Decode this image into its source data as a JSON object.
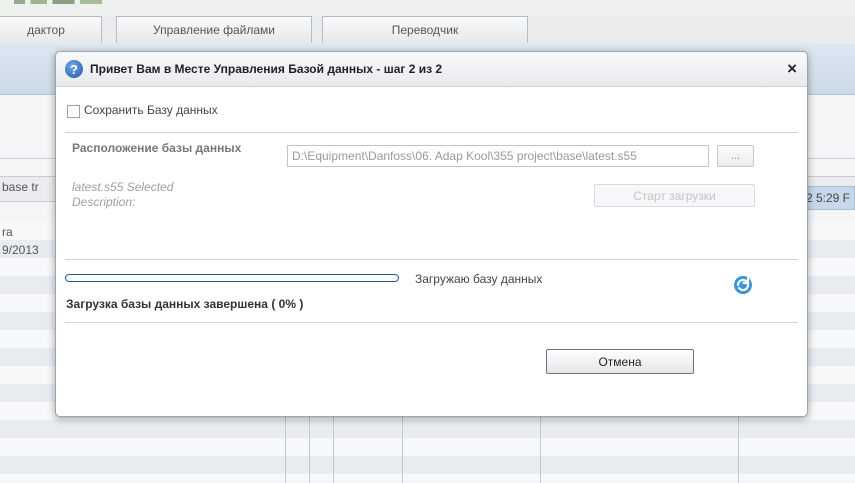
{
  "app": {
    "tabs": [
      {
        "label": "дактор"
      },
      {
        "label": "Управление файлами"
      },
      {
        "label": "Переводчик"
      }
    ],
    "bg_column_label": "base tr",
    "bg_row_label": "ra",
    "bg_row_date": "9/2013",
    "bg_time": "2 5:29 F"
  },
  "dialog": {
    "title": "Привет Вам в Месте Управления Базой данных - шаг 2 из 2",
    "close_glyph": "×",
    "help_glyph": "?",
    "save_checkbox_label": "Сохранить Базу данных",
    "save_checked": false,
    "location_label": "Расположение базы данных",
    "location_value": "D:\\Equipment\\Danfoss\\06. Adap Kool\\355 project\\base\\latest.s55",
    "browse_label": "...",
    "selected_text": "latest.s55 Selected",
    "description_text": "Description:",
    "start_button": "Старт загрузки",
    "progress_value": 0,
    "progress_status": "Загружаю базу данных",
    "completion_text": "Загрузка базы данных завершена ( 0% )",
    "cancel_button": "Отмена",
    "refresh_icon": "refresh-icon"
  },
  "colors": {
    "accent": "#3c7bc2",
    "title_bg": "#e7eaed",
    "refresh_icon": "#3a96d6"
  }
}
